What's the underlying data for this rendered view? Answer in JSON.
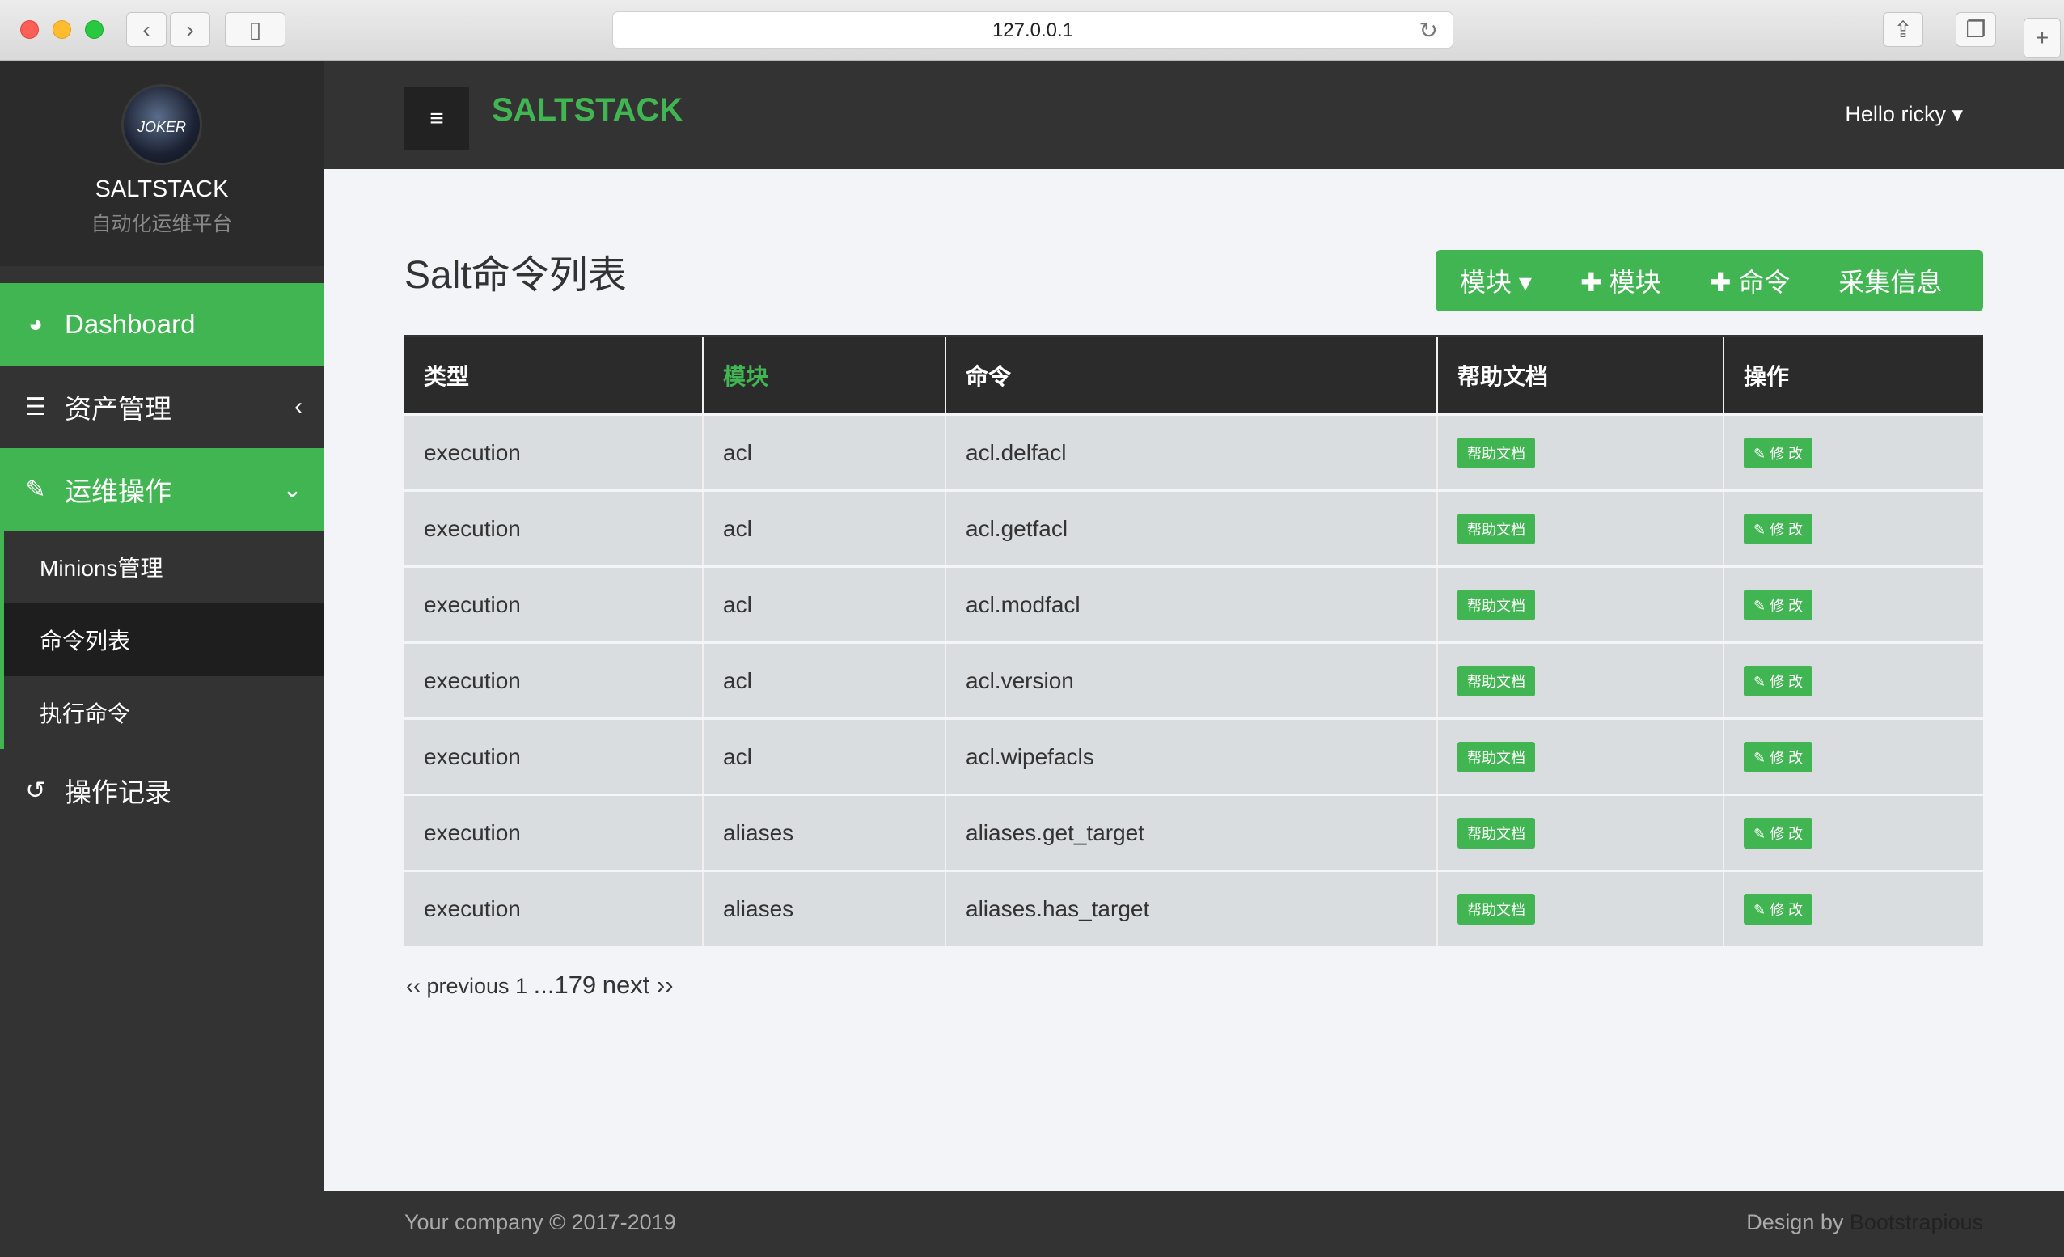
{
  "browser": {
    "url": "127.0.0.1",
    "back_icon": "chevron-left",
    "forward_icon": "chevron-right"
  },
  "sidebar": {
    "avatar_text": "JOKER",
    "brand_name": "SALTSTACK",
    "brand_sub": "自动化运维平台",
    "items": [
      {
        "label": "Dashboard",
        "icon": "dashboard-icon"
      },
      {
        "label": "资产管理",
        "icon": "server-icon"
      },
      {
        "label": "运维操作",
        "icon": "wrench-icon"
      },
      {
        "label": "操作记录",
        "icon": "history-icon"
      }
    ],
    "subitems": [
      {
        "label": "Minions管理"
      },
      {
        "label": "命令列表"
      },
      {
        "label": "执行命令"
      }
    ]
  },
  "topbar": {
    "title": "SALTSTACK",
    "user": "Hello ricky ▾"
  },
  "main": {
    "title": "Salt命令列表",
    "buttons": [
      "模块 ▾",
      "✚ 模块",
      "✚ 命令",
      "采集信息"
    ]
  },
  "table": {
    "headers": [
      "类型",
      "模块",
      "命令",
      "帮助文档",
      "操作"
    ],
    "help_label": "帮助文档",
    "edit_label": "✎ 修 改",
    "rows": [
      {
        "type": "execution",
        "module": "acl",
        "command": "acl.delfacl"
      },
      {
        "type": "execution",
        "module": "acl",
        "command": "acl.getfacl"
      },
      {
        "type": "execution",
        "module": "acl",
        "command": "acl.modfacl"
      },
      {
        "type": "execution",
        "module": "acl",
        "command": "acl.version"
      },
      {
        "type": "execution",
        "module": "acl",
        "command": "acl.wipefacls"
      },
      {
        "type": "execution",
        "module": "aliases",
        "command": "aliases.get_target"
      },
      {
        "type": "execution",
        "module": "aliases",
        "command": "aliases.has_target"
      }
    ]
  },
  "pagination": {
    "prev": "‹‹ previous",
    "current": "1",
    "ellipsis": "...",
    "last": "179",
    "next": "next ››"
  },
  "footer": {
    "left": "Your company © 2017-2019",
    "right_prefix": "Design by",
    "right_brand": "Bootstrapious"
  },
  "colors": {
    "accent": "#42b553",
    "dark": "#333333",
    "row": "#d9dde0"
  }
}
